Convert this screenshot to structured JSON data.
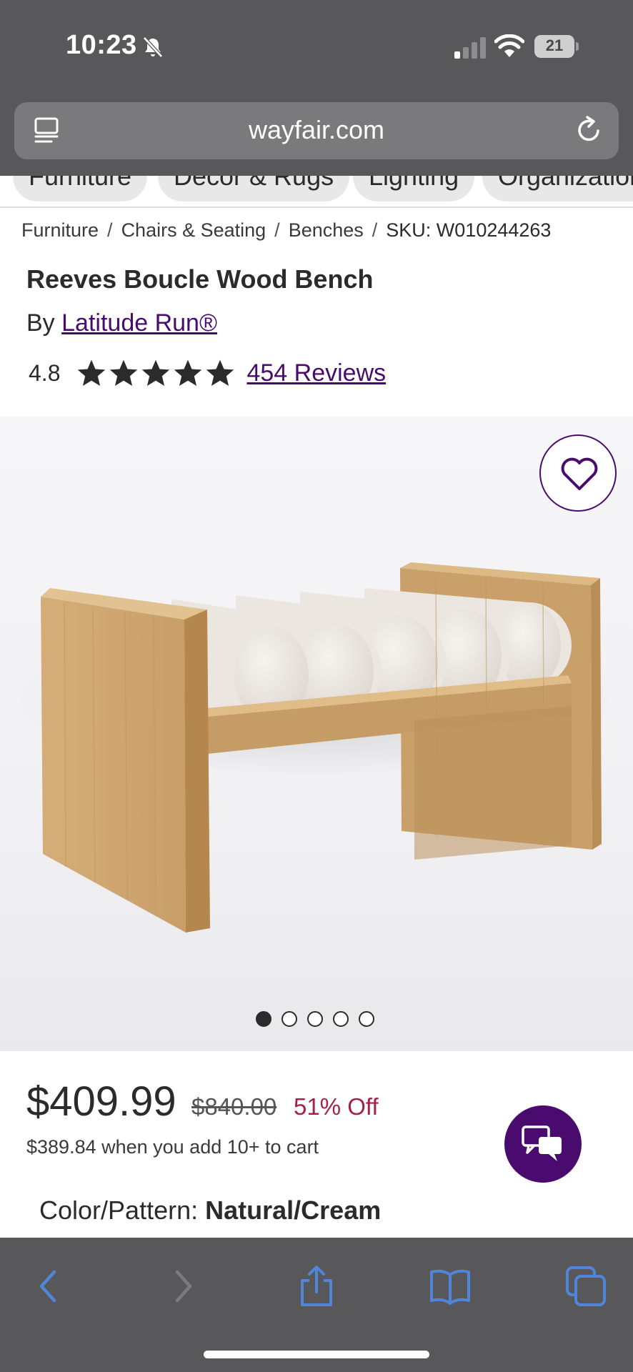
{
  "status_bar": {
    "time": "10:23",
    "battery": "21",
    "icons": [
      "bell-slash-icon",
      "signal-icon",
      "wifi-icon",
      "battery-icon"
    ]
  },
  "browser": {
    "url": "wayfair.com",
    "left_icon": "reader-icon",
    "right_icon": "reload-icon"
  },
  "categories": [
    "Furniture",
    "Decor & Rugs",
    "Lighting",
    "Organization"
  ],
  "breadcrumb": {
    "items": [
      "Furniture",
      "Chairs & Seating",
      "Benches"
    ],
    "separator": "/",
    "sku": "SKU: W010244263"
  },
  "product": {
    "title": "Reeves Boucle Wood Bench",
    "by_prefix": "By",
    "brand": "Latitude Run®",
    "rating": "4.8",
    "rating_value": 4.8,
    "star_count": 5,
    "reviews": "454 Reviews",
    "image_count": 5,
    "active_image": 0
  },
  "pricing": {
    "price": "$409.99",
    "original_price": "$840.00",
    "discount": "51% Off",
    "bulk_note": "$389.84 when you add 10+ to cart"
  },
  "options": {
    "color_label": "Color/Pattern:",
    "color_value": "Natural/Cream"
  },
  "toolbar": [
    "back-icon",
    "forward-icon",
    "share-icon",
    "bookmarks-icon",
    "tabs-icon"
  ],
  "colors": {
    "brand_purple": "#4a0b6e",
    "discount_red": "#a3214a",
    "chrome_gray": "#58585a",
    "toolbar_blue": "#4f86d9"
  }
}
